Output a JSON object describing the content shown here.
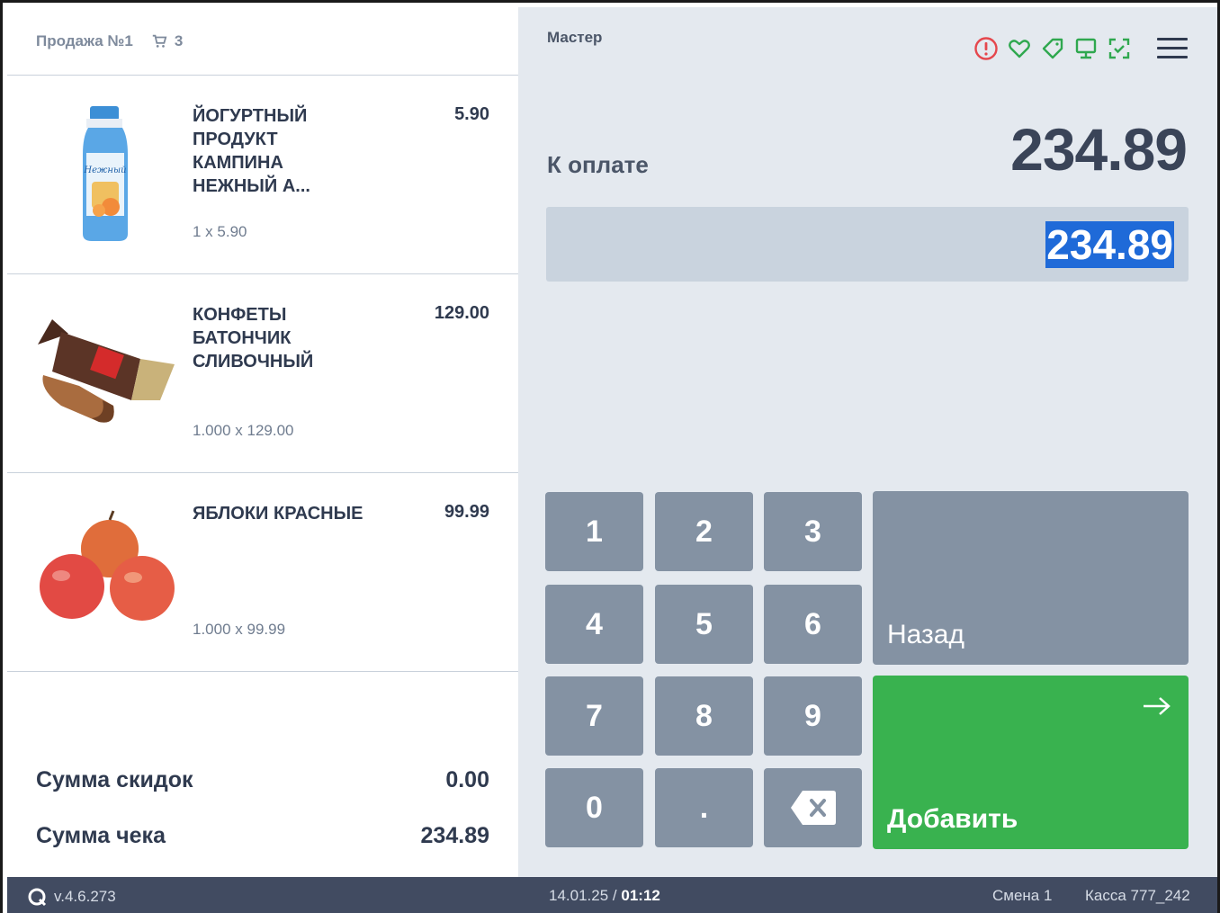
{
  "sale": {
    "title": "Продажа №1",
    "cart_count": "3",
    "items": [
      {
        "name": "ЙОГУРТНЫЙ ПРОДУКТ КАМПИНА НЕЖНЫЙ А...",
        "price": "5.90",
        "qty": "1 x 5.90",
        "image": "yogurt-bottle-image"
      },
      {
        "name": "КОНФЕТЫ БАТОНЧИК СЛИВОЧНЫЙ",
        "price": "129.00",
        "qty": "1.000 x 129.00",
        "image": "candy-image"
      },
      {
        "name": "ЯБЛОКИ КРАСНЫЕ",
        "price": "99.99",
        "qty": "1.000 x 99.99",
        "image": "apples-image"
      }
    ],
    "discount_label": "Сумма скидок",
    "discount_value": "0.00",
    "total_label": "Сумма чека",
    "total_value": "234.89"
  },
  "panel": {
    "mode": "Мастер",
    "pay_label": "К оплате",
    "pay_amount": "234.89",
    "input_value": "234.89",
    "status_icons": [
      "alert-icon",
      "heart-icon",
      "tag-icon",
      "monitor-icon",
      "scan-icon"
    ],
    "keys": [
      "1",
      "2",
      "3",
      "4",
      "5",
      "6",
      "7",
      "8",
      "9",
      "0",
      "."
    ],
    "back_label": "Назад",
    "add_label": "Добавить"
  },
  "statusbar": {
    "version": "v.4.6.273",
    "date": "14.01.25",
    "separator": "/",
    "time": "01:12",
    "shift": "Смена 1",
    "kassa": "Касса 777_242"
  },
  "colors": {
    "accent_green": "#39b24f",
    "key_gray": "#8492a3",
    "alert_red": "#e5474d",
    "status_green": "#2fa84f",
    "statusbar_bg": "#414b61",
    "selection_blue": "#1f6ad8"
  }
}
